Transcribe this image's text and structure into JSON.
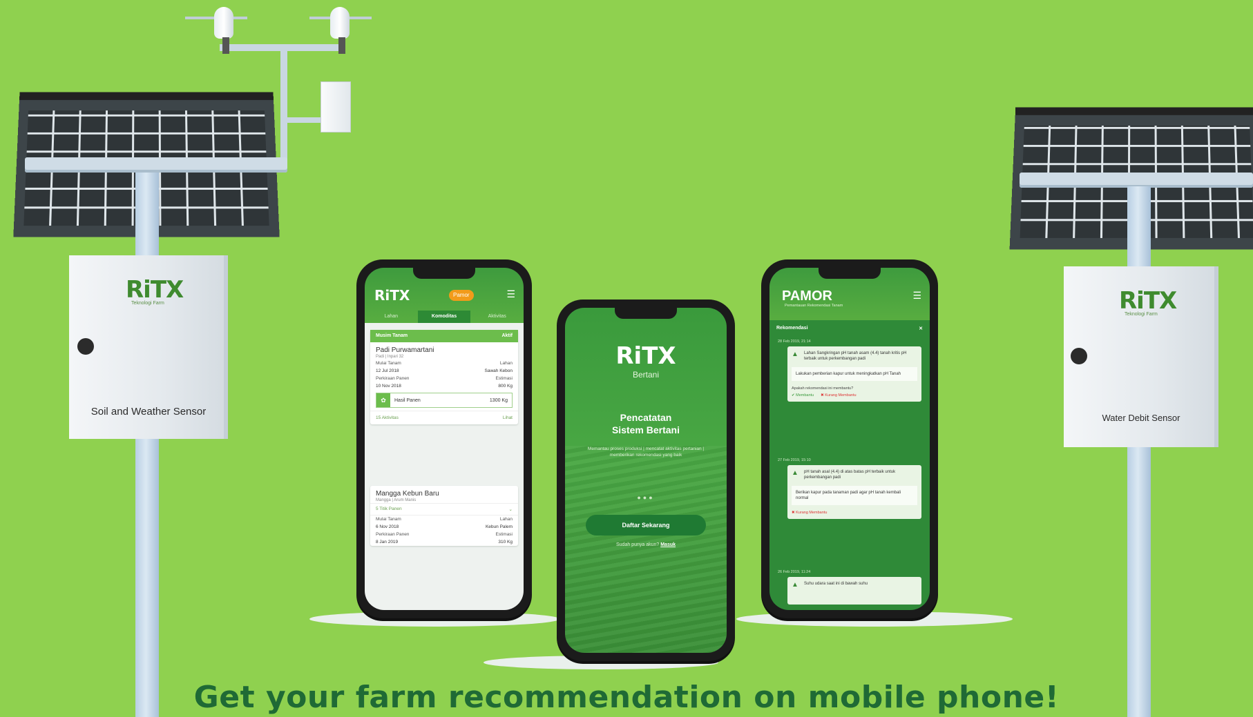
{
  "left_station": {
    "logo": "RiTX",
    "logo_tagline": "Teknologi Farm",
    "label": "Soil and Weather Sensor"
  },
  "right_station": {
    "logo": "RiTX",
    "logo_tagline": "Teknologi Farm",
    "label": "Water Debit Sensor"
  },
  "phone_left": {
    "logo": "RiTX",
    "badge": "Pamor",
    "tabs": [
      "Lahan",
      "Komoditas",
      "Aktivitas"
    ],
    "active_tab": "Komoditas",
    "card1": {
      "band_left": "Musim Tanam",
      "band_right": "Aktif",
      "title": "Padi Purwamartani",
      "subtitle": "Padi | Inpari 32",
      "row1": {
        "left_label": "Mulai Tanam",
        "left_value": "12 Jul 2018",
        "right_label": "Lahan",
        "right_value": "Sawah Kebon"
      },
      "row2": {
        "left_label": "Perkiraan Panen",
        "left_value": "10 Nov 2018",
        "right_label": "Estimasi",
        "right_value": "800 Kg"
      },
      "harvest_label": "Hasil Panen",
      "harvest_value": "1300 Kg",
      "foot_left": "15 Aktivitas",
      "foot_right": "Lihat"
    },
    "card2": {
      "title": "Mangga Kebun Baru",
      "subtitle": "Mangga | Arum Manis",
      "stage": "5 Titik Panen",
      "row1": {
        "left_label": "Mulai Tanam",
        "left_value": "6 Nov 2018",
        "right_label": "Lahan",
        "right_value": "Kebun Palem"
      },
      "row2": {
        "left_label": "Perkiraan Panen",
        "left_value": "8 Jan 2019",
        "right_label": "Estimasi",
        "right_value": "310 Kg"
      }
    }
  },
  "phone_center": {
    "logo": "RiTX",
    "logo_sub": "Bertani",
    "title_line1": "Pencatatan",
    "title_line2": "Sistem Bertani",
    "description": "Memantau proses produksi | mencatat aktivitas pertanian | memberikan rekomendasi yang baik",
    "button": "Daftar Sekarang",
    "login_prefix": "Sudah punya akun?",
    "login_link": "Masuk"
  },
  "phone_right": {
    "logo": "PAMOR",
    "tagline": "Pemantauan Rekomendasi Tanam",
    "section_title": "Rekomendasi",
    "rec1": {
      "date": "28 Feb 2019, 21:14",
      "text": "Lahan Sangkringan pH tanah asam (4.4) tanah kritis pH terbaik untuk perkembangan padi",
      "note": "Lakukan pemberian kapur untuk meningkatkan pH Tanah",
      "question": "Apakah rekomendasi ini membantu?",
      "yes": "Membantu",
      "no": "Kurang Membantu"
    },
    "rec2": {
      "date": "27 Feb 2019, 15:10",
      "text": "pH tanah asal (4.4) di atas batas pH terbaik untuk perkembangan padi",
      "note": "Berikan kapur pada tanaman padi agar pH tanah kembali normal",
      "status": "Kurang Membantu"
    },
    "rec3": {
      "date": "26 Feb 2019, 11:24",
      "text": "Suhu udara saat ini di bawah suhu"
    }
  },
  "headline": "Get your farm recommendation on mobile phone!"
}
